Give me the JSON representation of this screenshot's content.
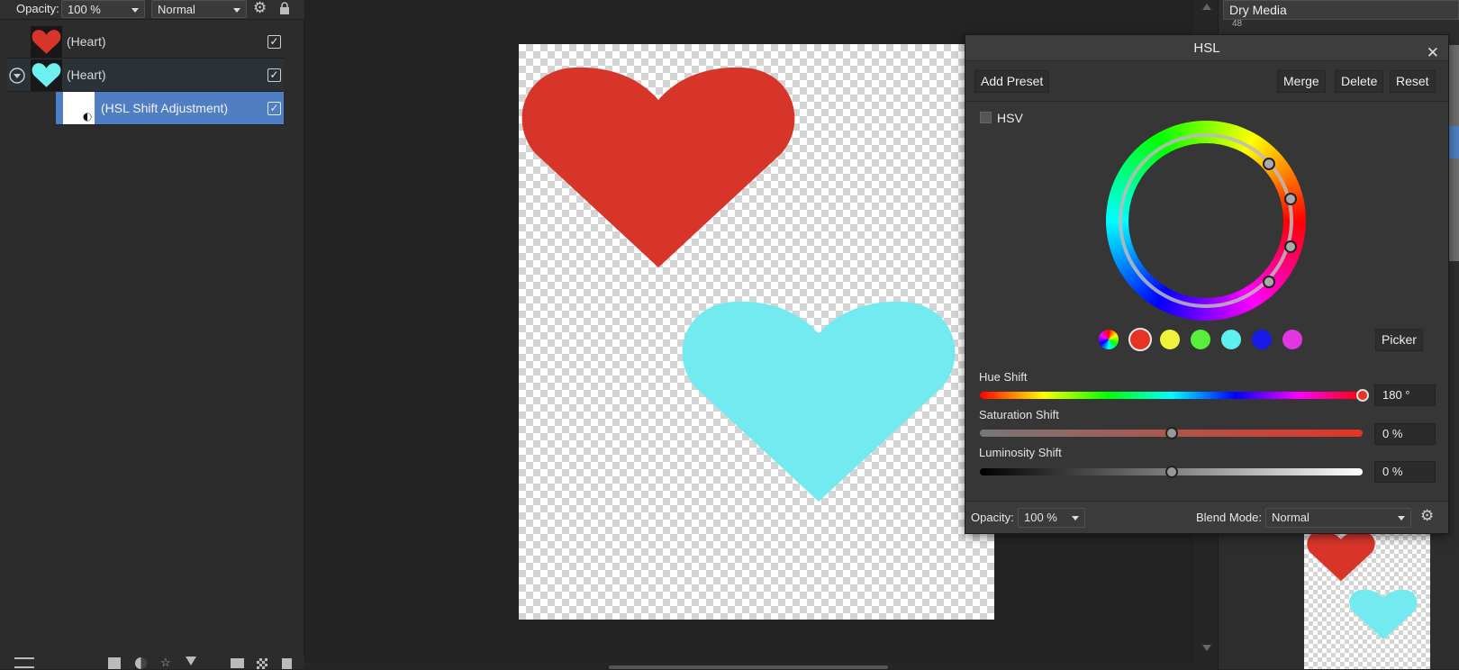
{
  "toolbar": {
    "opacity_label": "Opacity:",
    "opacity_value": "100 %",
    "blend_value": "Normal"
  },
  "layers": [
    {
      "name": "(Heart)",
      "thumb_color": "#d8352a",
      "checked": "✓"
    },
    {
      "name": "(Heart)",
      "thumb_color": "#6ff0f0",
      "checked": "✓"
    },
    {
      "name": "(HSL Shift Adjustment)",
      "checked": "✓",
      "selected": true
    }
  ],
  "brush_category": "Dry Media",
  "brush_size_hint": "48",
  "canvas": {
    "heart1_color": "#d8352a",
    "heart2_color": "#72eaef"
  },
  "hsl": {
    "title": "HSL",
    "add_preset": "Add Preset",
    "merge": "Merge",
    "delete": "Delete",
    "reset": "Reset",
    "hsv_label": "HSV",
    "picker": "Picker",
    "swatches": [
      "master",
      "#e53325",
      "#f2f23c",
      "#59ee3c",
      "#5fefef",
      "#1a1ae6",
      "#e236e2"
    ],
    "hue_shift": {
      "label": "Hue Shift",
      "value": "180 °",
      "fraction": 1.0
    },
    "saturation_shift": {
      "label": "Saturation Shift",
      "value": "0 %",
      "fraction": 0.5
    },
    "luminosity_shift": {
      "label": "Luminosity Shift",
      "value": "0 %",
      "fraction": 0.5
    },
    "footer": {
      "opacity_label": "Opacity:",
      "opacity_value": "100 %",
      "blend_label": "Blend Mode:",
      "blend_value": "Normal"
    }
  }
}
